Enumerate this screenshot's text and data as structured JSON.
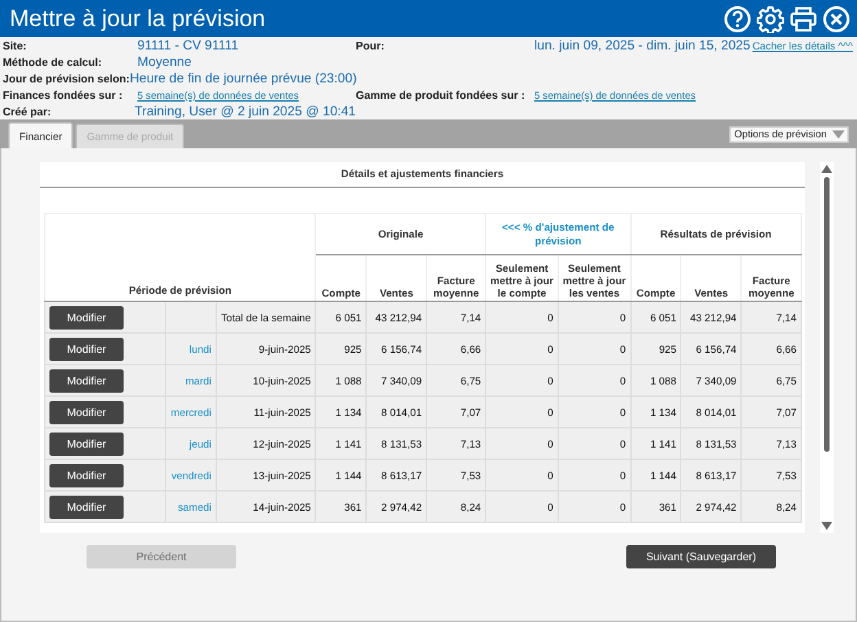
{
  "window": {
    "title": "Mettre à jour la prévision"
  },
  "details": {
    "left": [
      {
        "label": "Site:",
        "value": "91111 - CV 91111",
        "kind": "text"
      },
      {
        "label": "Méthode de calcul:",
        "value": "Moyenne",
        "kind": "text"
      },
      {
        "label": "Jour de prévision selon:",
        "value": "Heure de fin de journée prévue (23:00)",
        "kind": "text"
      },
      {
        "label": "Finances fondées sur :",
        "value": "5 semaine(s) de données de ventes",
        "kind": "link"
      },
      {
        "label": "Créé par:",
        "value": "Training, User @ 2 juin 2025 @ 10:41",
        "kind": "text"
      }
    ],
    "pour": {
      "label": "Pour:",
      "value": "lun. juin 09, 2025 - dim. juin 15, 2025"
    },
    "gamme": {
      "label": "Gamme de produit fondées sur :",
      "value": "5 semaine(s) de données de ventes"
    },
    "hide_link": "Cacher les détails ^^^"
  },
  "tabs": [
    {
      "label": "Financier",
      "selected": true
    },
    {
      "label": "Gamme de produit",
      "selected": false
    }
  ],
  "options_dropdown": "Options de prévision",
  "card_title": "Détails et ajustements financiers",
  "table": {
    "period_header": "Période de prévision",
    "groups": [
      {
        "label": "Originale",
        "kind": "plain",
        "columns": [
          "Compte",
          "Ventes",
          "Facture moyenne"
        ]
      },
      {
        "label": "<<< % d'ajustement de prévision",
        "kind": "link",
        "columns": [
          "Seulement mettre à jour le compte",
          "Seulement mettre à jour les ventes"
        ]
      },
      {
        "label": "Résultats de prévision",
        "kind": "plain",
        "columns": [
          "Compte",
          "Ventes",
          "Facture moyenne"
        ]
      }
    ],
    "rows": [
      {
        "button": "Modifier",
        "day": "",
        "date": "Total de la semaine",
        "values": [
          "6 051",
          "43 212,94",
          "7,14",
          "0",
          "0",
          "6 051",
          "43 212,94",
          "7,14"
        ]
      },
      {
        "button": "Modifier",
        "day": "lundi",
        "date": "9-juin-2025",
        "values": [
          "925",
          "6 156,74",
          "6,66",
          "0",
          "0",
          "925",
          "6 156,74",
          "6,66"
        ]
      },
      {
        "button": "Modifier",
        "day": "mardi",
        "date": "10-juin-2025",
        "values": [
          "1 088",
          "7 340,09",
          "6,75",
          "0",
          "0",
          "1 088",
          "7 340,09",
          "6,75"
        ]
      },
      {
        "button": "Modifier",
        "day": "mercredi",
        "date": "11-juin-2025",
        "values": [
          "1 134",
          "8 014,01",
          "7,07",
          "0",
          "0",
          "1 134",
          "8 014,01",
          "7,07"
        ]
      },
      {
        "button": "Modifier",
        "day": "jeudi",
        "date": "12-juin-2025",
        "values": [
          "1 141",
          "8 131,53",
          "7,13",
          "0",
          "0",
          "1 141",
          "8 131,53",
          "7,13"
        ]
      },
      {
        "button": "Modifier",
        "day": "vendredi",
        "date": "13-juin-2025",
        "values": [
          "1 144",
          "8 613,17",
          "7,53",
          "0",
          "0",
          "1 144",
          "8 613,17",
          "7,53"
        ]
      },
      {
        "button": "Modifier",
        "day": "samedi",
        "date": "14-juin-2025",
        "values": [
          "361",
          "2 974,42",
          "8,24",
          "0",
          "0",
          "361",
          "2 974,42",
          "8,24"
        ]
      }
    ]
  },
  "buttons": [
    {
      "label": "Précédent",
      "disabled": true
    },
    {
      "label": "Suivant (Sauvegarder)",
      "disabled": false
    }
  ]
}
